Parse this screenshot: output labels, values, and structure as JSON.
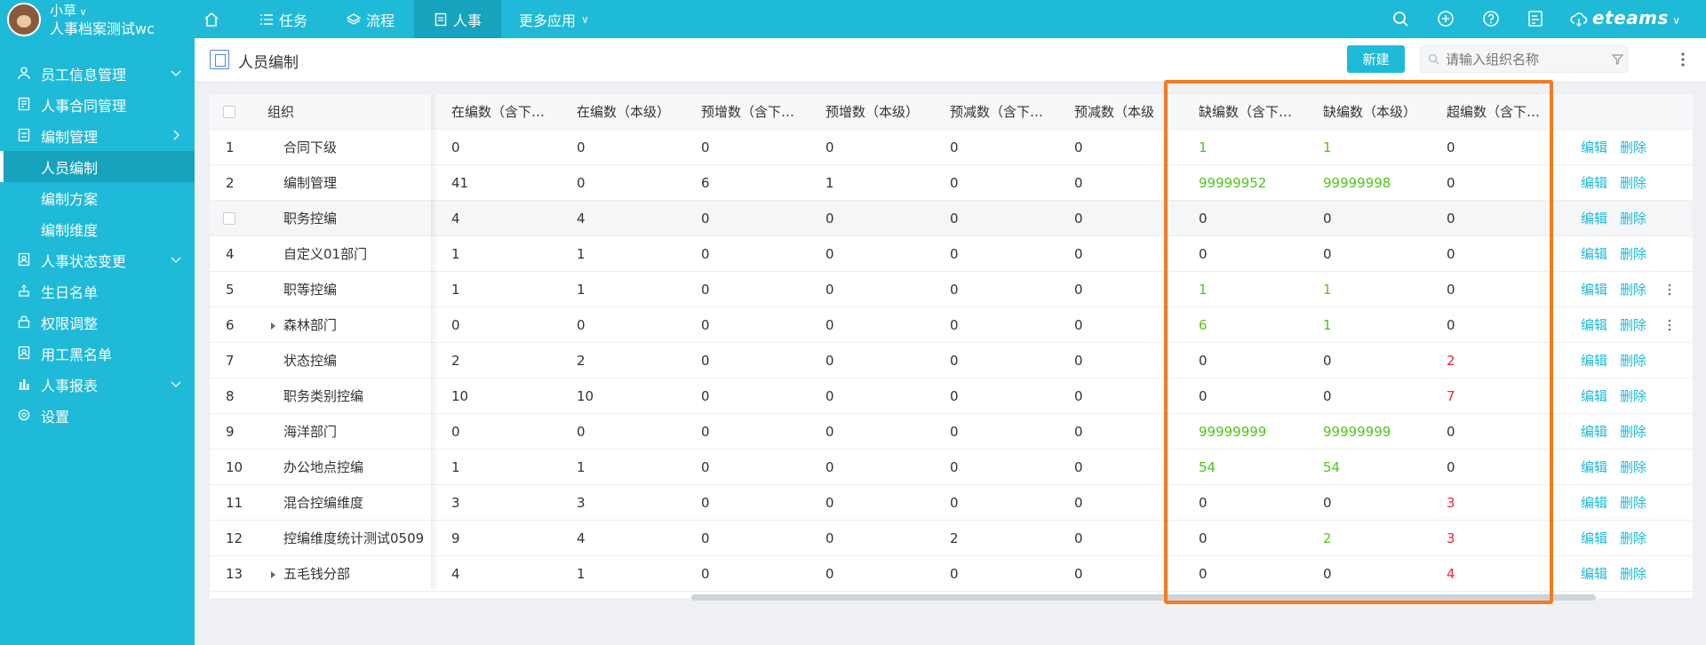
{
  "topbar": {
    "user_name": "小草",
    "org_name": "人事档案测试wc",
    "nav": [
      {
        "label": ""
      },
      {
        "label": "任务"
      },
      {
        "label": "流程"
      },
      {
        "label": "人事"
      },
      {
        "label": "更多应用"
      }
    ],
    "brand": "eteams"
  },
  "sidebar": {
    "items": [
      {
        "label": "员工信息管理"
      },
      {
        "label": "人事合同管理"
      },
      {
        "label": "编制管理"
      },
      {
        "label": "人员编制"
      },
      {
        "label": "编制方案"
      },
      {
        "label": "编制维度"
      },
      {
        "label": "人事状态变更"
      },
      {
        "label": "生日名单"
      },
      {
        "label": "权限调整"
      },
      {
        "label": "用工黑名单"
      },
      {
        "label": "人事报表"
      },
      {
        "label": "设置"
      }
    ]
  },
  "page": {
    "title": "人员编制",
    "new_button": "新建",
    "search_placeholder": "请输入组织名称"
  },
  "table": {
    "columns": [
      "组织",
      "在编数（含下…",
      "在编数（本级）",
      "预增数（含下…",
      "预增数（本级）",
      "预减数（含下…",
      "预减数（本级",
      "缺编数（含下…",
      "缺编数（本级）",
      "超编数（含下…"
    ],
    "action_edit": "编辑",
    "action_delete": "删除",
    "rows": [
      {
        "no": "1",
        "org": "合同下级",
        "v": [
          "0",
          "0",
          "0",
          "0",
          "0",
          "0",
          "1",
          "1",
          "0"
        ]
      },
      {
        "no": "2",
        "org": "编制管理",
        "v": [
          "41",
          "0",
          "6",
          "1",
          "0",
          "0",
          "99999952",
          "99999998",
          "0"
        ]
      },
      {
        "no": "",
        "org": "职务控编",
        "v": [
          "4",
          "4",
          "0",
          "0",
          "0",
          "0",
          "0",
          "0",
          "0"
        ]
      },
      {
        "no": "4",
        "org": "自定义01部门",
        "v": [
          "1",
          "1",
          "0",
          "0",
          "0",
          "0",
          "0",
          "0",
          "0"
        ]
      },
      {
        "no": "5",
        "org": "职等控编",
        "v": [
          "1",
          "1",
          "0",
          "0",
          "0",
          "0",
          "1",
          "1",
          "0"
        ]
      },
      {
        "no": "6",
        "org": "森林部门",
        "v": [
          "0",
          "0",
          "0",
          "0",
          "0",
          "0",
          "6",
          "1",
          "0"
        ]
      },
      {
        "no": "7",
        "org": "状态控编",
        "v": [
          "2",
          "2",
          "0",
          "0",
          "0",
          "0",
          "0",
          "0",
          "2"
        ]
      },
      {
        "no": "8",
        "org": "职务类别控编",
        "v": [
          "10",
          "10",
          "0",
          "0",
          "0",
          "0",
          "0",
          "0",
          "7"
        ]
      },
      {
        "no": "9",
        "org": "海洋部门",
        "v": [
          "0",
          "0",
          "0",
          "0",
          "0",
          "0",
          "99999999",
          "99999999",
          "0"
        ]
      },
      {
        "no": "10",
        "org": "办公地点控编",
        "v": [
          "1",
          "1",
          "0",
          "0",
          "0",
          "0",
          "54",
          "54",
          "0"
        ]
      },
      {
        "no": "11",
        "org": "混合控编维度",
        "v": [
          "3",
          "3",
          "0",
          "0",
          "0",
          "0",
          "0",
          "0",
          "3"
        ]
      },
      {
        "no": "12",
        "org": "控编维度统计测试0509",
        "v": [
          "9",
          "4",
          "0",
          "0",
          "2",
          "0",
          "0",
          "2",
          "3"
        ]
      },
      {
        "no": "13",
        "org": "五毛钱分部",
        "v": [
          "4",
          "1",
          "0",
          "0",
          "0",
          "0",
          "0",
          "0",
          "4"
        ]
      }
    ]
  },
  "colors": {
    "accent": "#1ebad8",
    "green": "#52c41a",
    "red": "#f5222d",
    "highlight_box": "#f47b22"
  }
}
